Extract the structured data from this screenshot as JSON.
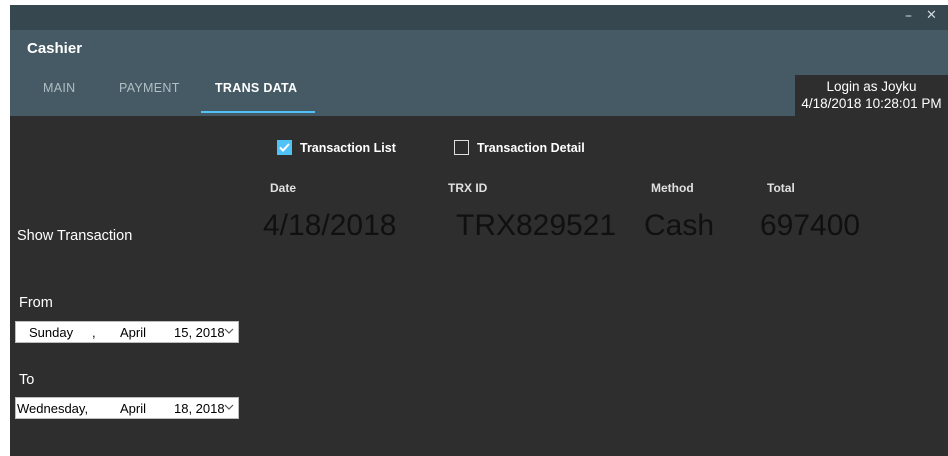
{
  "window": {
    "minimize_glyph": "–",
    "close_glyph": "✕"
  },
  "app": {
    "title": "Cashier"
  },
  "tabs": [
    {
      "label": "MAIN"
    },
    {
      "label": "PAYMENT"
    },
    {
      "label": "TRANS DATA",
      "active": true
    }
  ],
  "login": {
    "line1": "Login as Joyku",
    "line2": "4/18/2018 10:28:01 PM"
  },
  "options": {
    "transaction_list": {
      "label": "Transaction List",
      "checked": true
    },
    "transaction_detail": {
      "label": "Transaction Detail",
      "checked": false
    }
  },
  "table": {
    "headers": [
      "Date",
      "TRX ID",
      "Method",
      "Total"
    ],
    "row": [
      "4/18/2018",
      "TRX829521",
      "Cash",
      "697400"
    ]
  },
  "filter": {
    "show_label": "Show Transaction",
    "from_label": "From",
    "from": {
      "day": "Sunday",
      "sep": ",",
      "month": "April",
      "date": "15, 2018"
    },
    "to_label": "To",
    "to": {
      "day": "Wednesday,",
      "month": "April",
      "date": "18, 2018"
    }
  },
  "colors": {
    "accent": "#4fc3f7",
    "header": "#455a64",
    "titlebar": "#37474f",
    "body": "#2e2e2e"
  },
  "icons": [
    "minimize-icon",
    "close-icon",
    "checkbox-checked-icon",
    "checkbox-unchecked-icon",
    "chevron-down-icon"
  ]
}
